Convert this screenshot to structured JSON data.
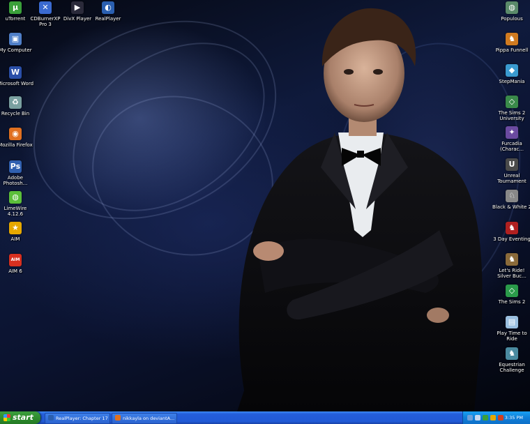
{
  "desktop_icons_left": [
    {
      "label": "uTorrent",
      "icon": "utorrent-icon",
      "color": "#3aa03a",
      "glyph": "µ"
    },
    {
      "label": "My Computer",
      "icon": "my-computer-icon",
      "color": "#4f7fc8",
      "glyph": "▣"
    },
    {
      "label": "Microsoft Word",
      "icon": "word-icon",
      "color": "#2a4fa8",
      "glyph": "W"
    },
    {
      "label": "Recycle Bin",
      "icon": "recycle-bin-icon",
      "color": "#7aa0a0",
      "glyph": "♻"
    },
    {
      "label": "Mozilla Firefox",
      "icon": "firefox-icon",
      "color": "#e07020",
      "glyph": "◉"
    },
    {
      "label": "Adobe Photosh...",
      "icon": "photoshop-icon",
      "color": "#3060b0",
      "glyph": "Ps"
    },
    {
      "label": "LimeWire 4.12.6",
      "icon": "limewire-icon",
      "color": "#5bbf3a",
      "glyph": "◍"
    },
    {
      "label": "AIM",
      "icon": "aim-icon",
      "color": "#e6a800",
      "glyph": "★"
    },
    {
      "label": "AIM 6",
      "icon": "aim6-icon",
      "color": "#d83020",
      "glyph": "AIM"
    }
  ],
  "desktop_icons_top": [
    {
      "label": "CDBurnerXP Pro 3",
      "icon": "cdburner-icon",
      "color": "#3a6ad0",
      "glyph": "✕"
    },
    {
      "label": "DivX Player",
      "icon": "divx-icon",
      "color": "#2a2a3a",
      "glyph": "▶"
    },
    {
      "label": "RealPlayer",
      "icon": "realplayer-icon",
      "color": "#2a5fb0",
      "glyph": "◐"
    }
  ],
  "desktop_icons_right": [
    {
      "label": "Populous",
      "icon": "populous-icon",
      "color": "#5a8a6a",
      "glyph": "◍"
    },
    {
      "label": "Pippa Funnell",
      "icon": "pippa-funnell-icon",
      "color": "#d07a20",
      "glyph": "♞"
    },
    {
      "label": "StepMania",
      "icon": "stepmania-icon",
      "color": "#3a9ad0",
      "glyph": "◆"
    },
    {
      "label": "The Sims 2 University",
      "icon": "sims-university-icon",
      "color": "#3a8a4a",
      "glyph": "◇"
    },
    {
      "label": "Furcadia (Charac...",
      "icon": "furcadia-icon",
      "color": "#6a4aa0",
      "glyph": "✦"
    },
    {
      "label": "Unreal Tournament",
      "icon": "unreal-icon",
      "color": "#4a4a4a",
      "glyph": "U"
    },
    {
      "label": "Black & White 2",
      "icon": "black-white-icon",
      "color": "#888888",
      "glyph": "♘"
    },
    {
      "label": "3 Day Eventing",
      "icon": "3day-eventing-icon",
      "color": "#b02020",
      "glyph": "♞"
    },
    {
      "label": "Let's Ride! Silver Buc...",
      "icon": "lets-ride-icon",
      "color": "#8a6a3a",
      "glyph": "♞"
    },
    {
      "label": "The Sims 2",
      "icon": "sims2-icon",
      "color": "#2a9a4a",
      "glyph": "◇"
    },
    {
      "label": "Play Time to Ride",
      "icon": "play-time-ride-icon",
      "color": "#9abfe0",
      "glyph": "▤"
    },
    {
      "label": "Equestrian Challenge",
      "icon": "equestrian-icon",
      "color": "#4a8aa0",
      "glyph": "♞"
    }
  ],
  "taskbar": {
    "start_label": "start",
    "tasks": [
      {
        "label": "RealPlayer: Chapter 17",
        "icon": "realplayer-task-icon",
        "color": "#2a5fb0"
      },
      {
        "label": "nikkayla on deviantA...",
        "icon": "firefox-task-icon",
        "color": "#e07020"
      }
    ],
    "clock": "3:35 PM"
  }
}
